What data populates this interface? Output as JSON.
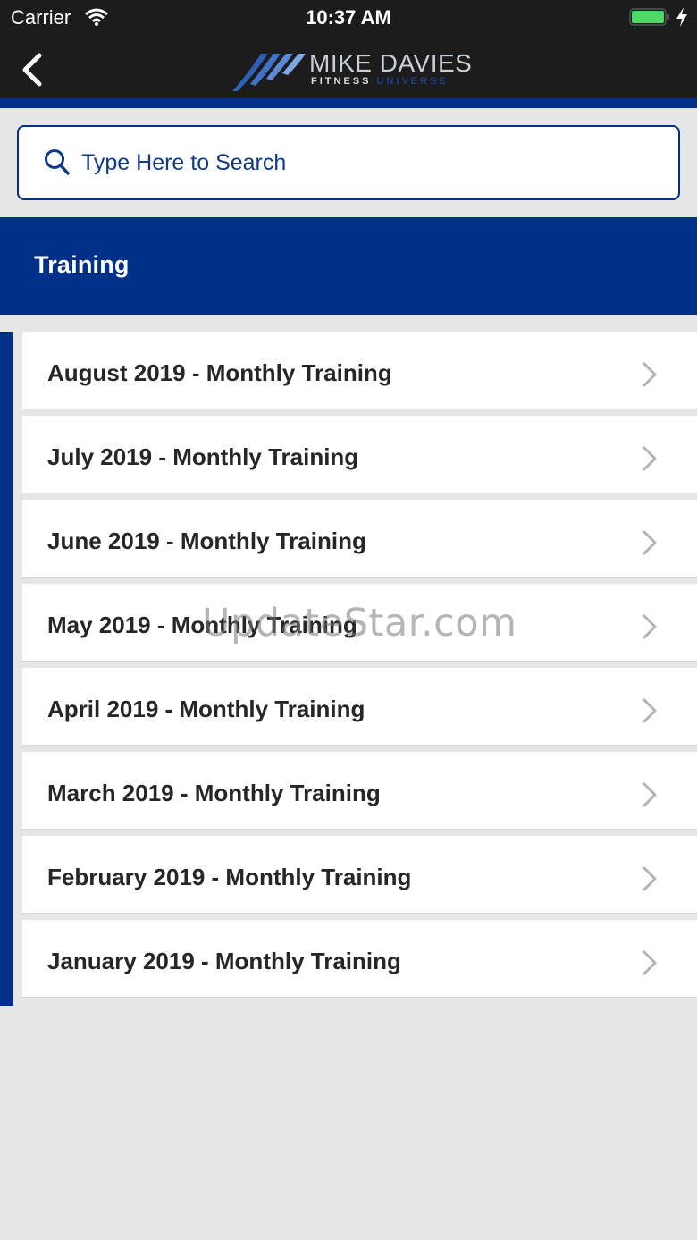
{
  "status_bar": {
    "carrier": "Carrier",
    "time": "10:37 AM",
    "battery_color": "#4cd964"
  },
  "nav": {
    "back_icon": "chevron-left-icon",
    "logo": {
      "name": "MIKE DAVIES",
      "sub_left": "FITNESS",
      "sub_right": "UNIVERSE"
    }
  },
  "search": {
    "placeholder": "Type Here to Search",
    "value": ""
  },
  "section": {
    "title": "Training"
  },
  "items": [
    {
      "label": "August 2019 - Monthly Training"
    },
    {
      "label": "July 2019 - Monthly Training"
    },
    {
      "label": "June 2019 - Monthly Training"
    },
    {
      "label": "May 2019 - Monthly Training"
    },
    {
      "label": "April 2019 - Monthly Training"
    },
    {
      "label": "March 2019 - Monthly Training"
    },
    {
      "label": "February 2019 - Monthly Training"
    },
    {
      "label": "January 2019 - Monthly Training"
    }
  ],
  "watermark": "UpdateStar.com",
  "colors": {
    "brand_blue": "#003087",
    "nav_bg": "#1c1c1c",
    "background": "#e6e6e6"
  }
}
